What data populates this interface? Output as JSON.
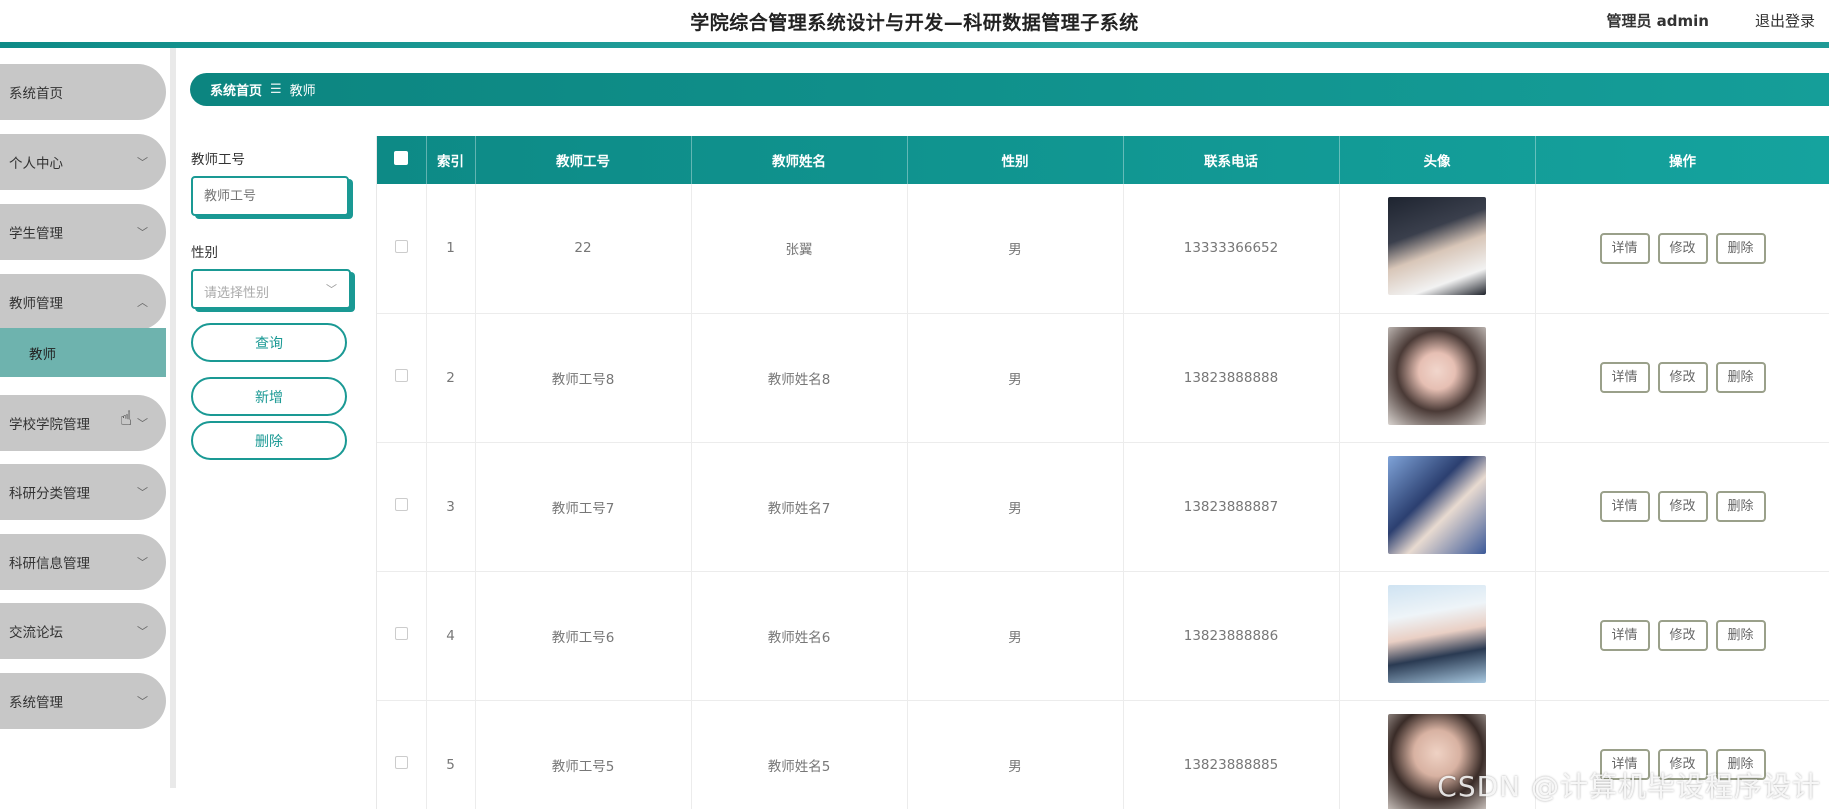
{
  "header": {
    "title": "学院综合管理系统设计与开发—科研数据管理子系统",
    "user": "管理员 admin",
    "logout": "退出登录"
  },
  "sidebar": {
    "items": [
      {
        "label": "系统首页"
      },
      {
        "label": "个人中心"
      },
      {
        "label": "学生管理"
      },
      {
        "label": "教师管理"
      },
      {
        "label": "学校学院管理"
      },
      {
        "label": "科研分类管理"
      },
      {
        "label": "科研信息管理"
      },
      {
        "label": "交流论坛"
      },
      {
        "label": "系统管理"
      }
    ],
    "sub_item": "教师"
  },
  "breadcrumb": {
    "home": "系统首页",
    "separator": "☰",
    "current": "教师"
  },
  "search": {
    "id_label": "教师工号",
    "id_placeholder": "教师工号",
    "gender_label": "性别",
    "gender_placeholder": "请选择性别",
    "query_button": "查询",
    "add_button": "新增",
    "delete_button": "删除"
  },
  "table": {
    "columns": [
      "索引",
      "教师工号",
      "教师姓名",
      "性别",
      "联系电话",
      "头像",
      "操作"
    ],
    "action_labels": {
      "detail": "详情",
      "edit": "修改",
      "delete": "删除"
    },
    "rows": [
      {
        "index": "1",
        "id": "22",
        "name": "张翼",
        "gender": "男",
        "phone": "13333366652"
      },
      {
        "index": "2",
        "id": "教师工号8",
        "name": "教师姓名8",
        "gender": "男",
        "phone": "13823888888"
      },
      {
        "index": "3",
        "id": "教师工号7",
        "name": "教师姓名7",
        "gender": "男",
        "phone": "13823888887"
      },
      {
        "index": "4",
        "id": "教师工号6",
        "name": "教师姓名6",
        "gender": "男",
        "phone": "13823888886"
      },
      {
        "index": "5",
        "id": "教师工号5",
        "name": "教师姓名5",
        "gender": "男",
        "phone": "13823888885"
      }
    ]
  },
  "watermark": "CSDN @计算机毕设程序设计",
  "colors": {
    "accent": "#159e99",
    "sidebar_item": "#c7c7c7",
    "sidebar_active": "#6eb3ae"
  }
}
